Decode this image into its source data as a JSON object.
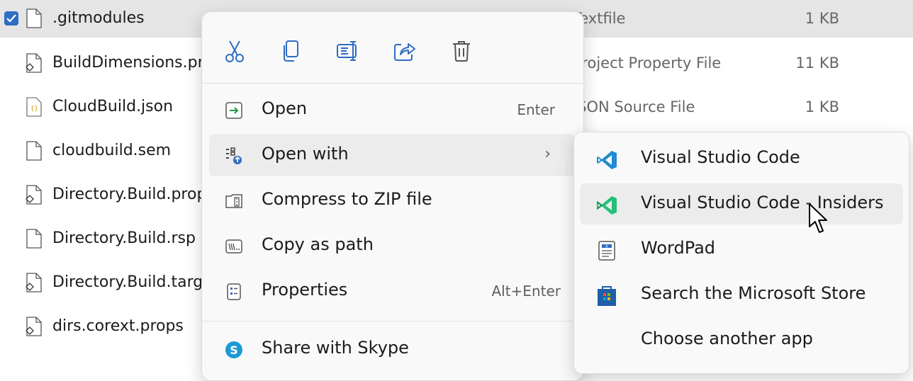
{
  "files": [
    {
      "name": ".gitmodules",
      "type": "Textfile",
      "size": "1 KB",
      "selected": true,
      "icon": "plain-file-icon"
    },
    {
      "name": "BuildDimensions.pr",
      "type": "Project Property File",
      "size": "11 KB",
      "icon": "project-file-icon"
    },
    {
      "name": "CloudBuild.json",
      "type": "JSON Source File",
      "size": "1 KB",
      "icon": "json-file-icon"
    },
    {
      "name": "cloudbuild.sem",
      "type": "",
      "size": "",
      "icon": "plain-file-icon"
    },
    {
      "name": "Directory.Build.prop",
      "type": "",
      "size": "",
      "icon": "project-file-icon"
    },
    {
      "name": "Directory.Build.rsp",
      "type": "",
      "size": "",
      "icon": "plain-file-icon"
    },
    {
      "name": "Directory.Build.targ",
      "type": "",
      "size": "",
      "icon": "project-file-icon"
    },
    {
      "name": "dirs.corext.props",
      "type": "",
      "size": "",
      "icon": "project-file-icon"
    }
  ],
  "context_menu": {
    "toolbar": [
      {
        "name": "cut-icon",
        "tooltip": "Cut"
      },
      {
        "name": "copy-icon",
        "tooltip": "Copy"
      },
      {
        "name": "rename-icon",
        "tooltip": "Rename"
      },
      {
        "name": "share-icon",
        "tooltip": "Share"
      },
      {
        "name": "delete-icon",
        "tooltip": "Delete"
      }
    ],
    "items": [
      {
        "label": "Open",
        "shortcut": "Enter",
        "icon": "open-icon"
      },
      {
        "label": "Open with",
        "shortcut": "",
        "icon": "open-with-icon",
        "submenu": true
      },
      {
        "label": "Compress to ZIP file",
        "shortcut": "",
        "icon": "zip-icon"
      },
      {
        "label": "Copy as path",
        "shortcut": "",
        "icon": "copy-path-icon"
      },
      {
        "label": "Properties",
        "shortcut": "Alt+Enter",
        "icon": "properties-icon"
      },
      {
        "label": "Share with Skype",
        "shortcut": "",
        "icon": "skype-icon"
      }
    ]
  },
  "open_with_submenu": {
    "items": [
      {
        "label": "Visual Studio Code",
        "icon": "vscode-icon"
      },
      {
        "label": "Visual Studio Code - Insiders",
        "icon": "vscode-insiders-icon",
        "hovered": true
      },
      {
        "label": "WordPad",
        "icon": "wordpad-icon"
      },
      {
        "label": "Search the Microsoft Store",
        "icon": "microsoft-store-icon"
      },
      {
        "label": "Choose another app",
        "icon": ""
      }
    ]
  },
  "colors": {
    "accent": "#2f6cc2",
    "vscode_blue": "#1f8ad2",
    "vscode_insiders_green": "#24bf76",
    "selection_bg": "#e5e5e5",
    "menu_bg": "#f9f9f9"
  }
}
